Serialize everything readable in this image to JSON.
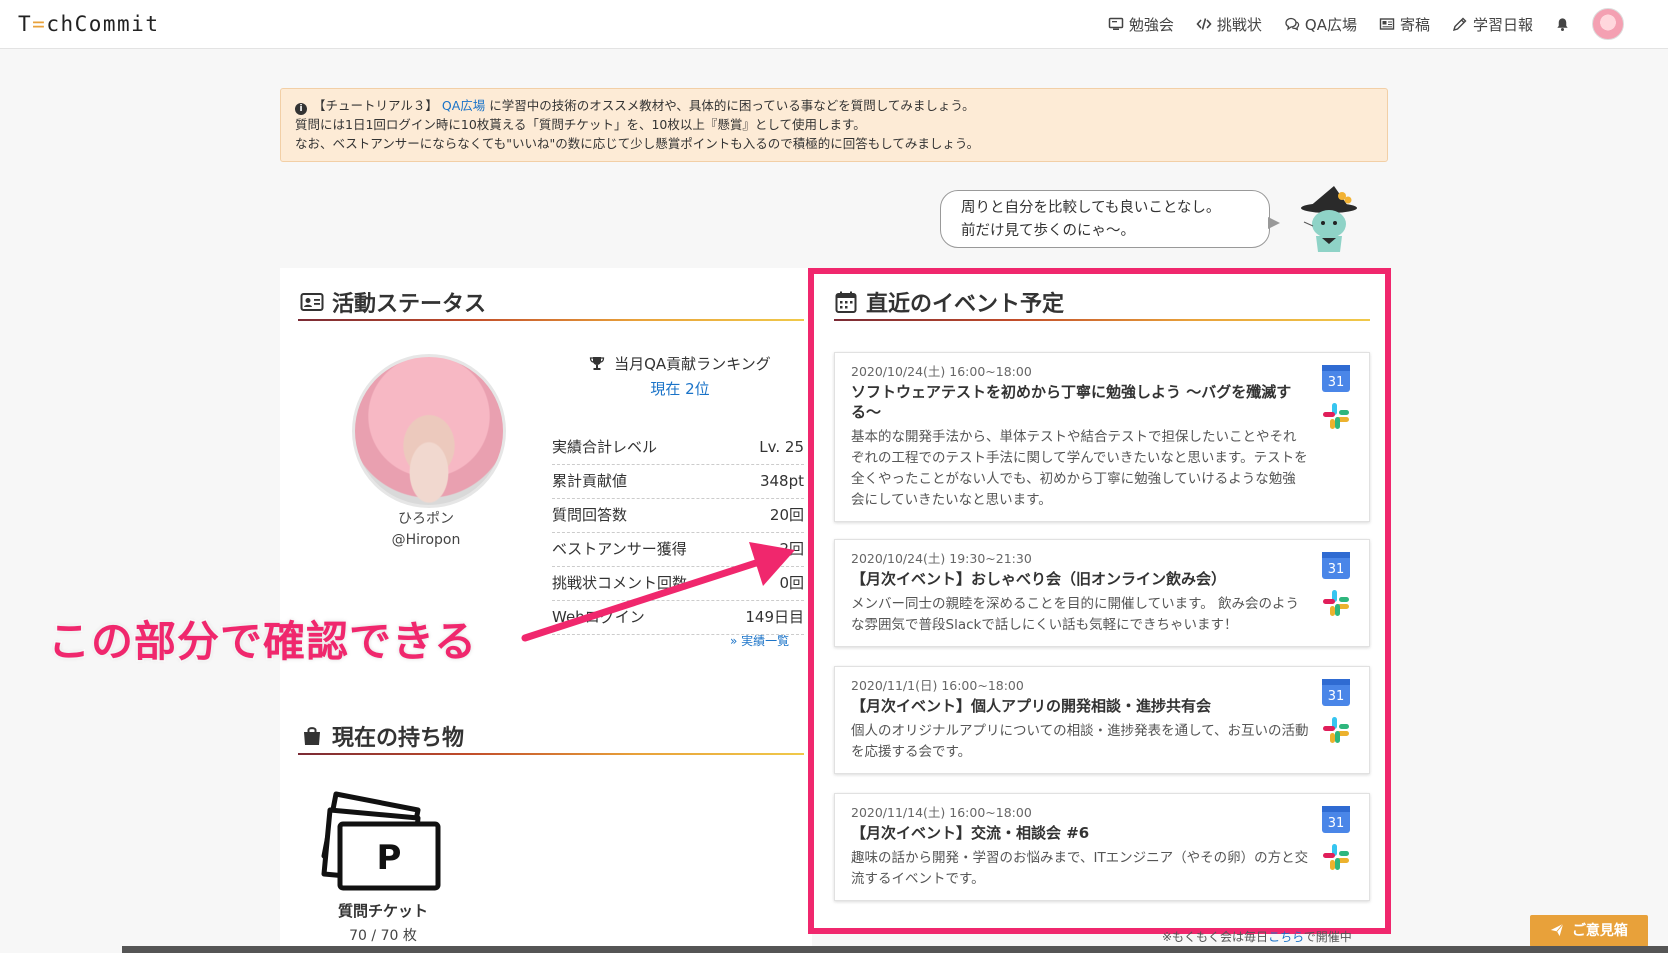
{
  "header": {
    "logo": {
      "pre": "T",
      "mid": "=",
      "post": "chCommit"
    },
    "nav": [
      {
        "label": "勉強会",
        "icon": "monitor-icon"
      },
      {
        "label": "挑戦状",
        "icon": "code-icon"
      },
      {
        "label": "QA広場",
        "icon": "chat-icon"
      },
      {
        "label": "寄稿",
        "icon": "newspaper-icon"
      },
      {
        "label": "学習日報",
        "icon": "pencil-icon"
      }
    ]
  },
  "notice": {
    "line1_prefix": "【チュートリアル３】",
    "line1_link": "QA広場",
    "line1_suffix": "に学習中の技術のオススメ教材や、具体的に困っている事などを質問してみましょう。",
    "line2": "質問には1日1回ログイン時に10枚貰える「質問チケット」を、10枚以上『懸賞』として使用します。",
    "line3": "なお、ベストアンサーにならなくても\"いいね\"の数に応じて少し懸賞ポイントも入るので積極的に回答もしてみましょう。"
  },
  "bubble": {
    "line1": "周りと自分を比較しても良いことなし。",
    "line2": "前だけ見て歩くのにゃ〜。"
  },
  "status": {
    "title": "活動ステータス",
    "user_name": "ひろポン",
    "user_handle": "@Hiropon",
    "rank_label": "当月QA貢献ランキング",
    "rank_value": "現在 2位",
    "stats": [
      {
        "label": "実績合計レベル",
        "value": "Lv. 25"
      },
      {
        "label": "累計貢献値",
        "value": "348pt"
      },
      {
        "label": "質問回答数",
        "value": "20回"
      },
      {
        "label": "ベストアンサー獲得",
        "value": "2回"
      },
      {
        "label": "挑戦状コメント回数",
        "value": "0回"
      },
      {
        "label": "Webログイン",
        "value": "149日目"
      }
    ],
    "more_link": "実績一覧"
  },
  "inventory": {
    "title": "現在の持ち物",
    "item_name": "質問チケット",
    "item_count": "70 / 70 枚",
    "ticket_letter": "P"
  },
  "events": {
    "title": "直近のイベント予定",
    "gcal_day": "31",
    "items": [
      {
        "date": "2020/10/24(土) 16:00~18:00",
        "title": "ソフトウェアテストを初めから丁寧に勉強しよう 〜バグを殲滅する〜",
        "desc": "基本的な開発手法から、単体テストや結合テストで担保したいことやそれぞれの工程でのテスト手法に関して学んでいきたいなと思います。テストを全くやったことがない人でも、初めから丁寧に勉強していけるような勉強会にしていきたいなと思います。"
      },
      {
        "date": "2020/10/24(土) 19:30~21:30",
        "title": "【月次イベント】おしゃべり会（旧オンライン飲み会）",
        "desc": "メンバー同士の親睦を深めることを目的に開催しています。 飲み会のような雰囲気で普段Slackで話しにくい話も気軽にできちゃいます！"
      },
      {
        "date": "2020/11/1(日) 16:00~18:00",
        "title": "【月次イベント】個人アプリの開発相談・進捗共有会",
        "desc": "個人のオリジナルアプリについての相談・進捗発表を通して、お互いの活動を応援する会です。"
      },
      {
        "date": "2020/11/14(土) 16:00~18:00",
        "title": "【月次イベント】交流・相談会 #6",
        "desc": "趣味の話から開発・学習のお悩みまで、ITエンジニア（やその卵）の方と交流するイベントです。"
      }
    ],
    "footnote_prefix": "※もくもく会は毎日",
    "footnote_link": "こちら",
    "footnote_suffix": "で開催中"
  },
  "feedback_button": "ご意見箱",
  "annotation": "この部分で確認できる",
  "colors": {
    "accent_pink": "#f0276d",
    "notice_bg": "#fdebd6",
    "link_blue": "#1a73c8",
    "feedback_orange": "#e8a13a"
  }
}
